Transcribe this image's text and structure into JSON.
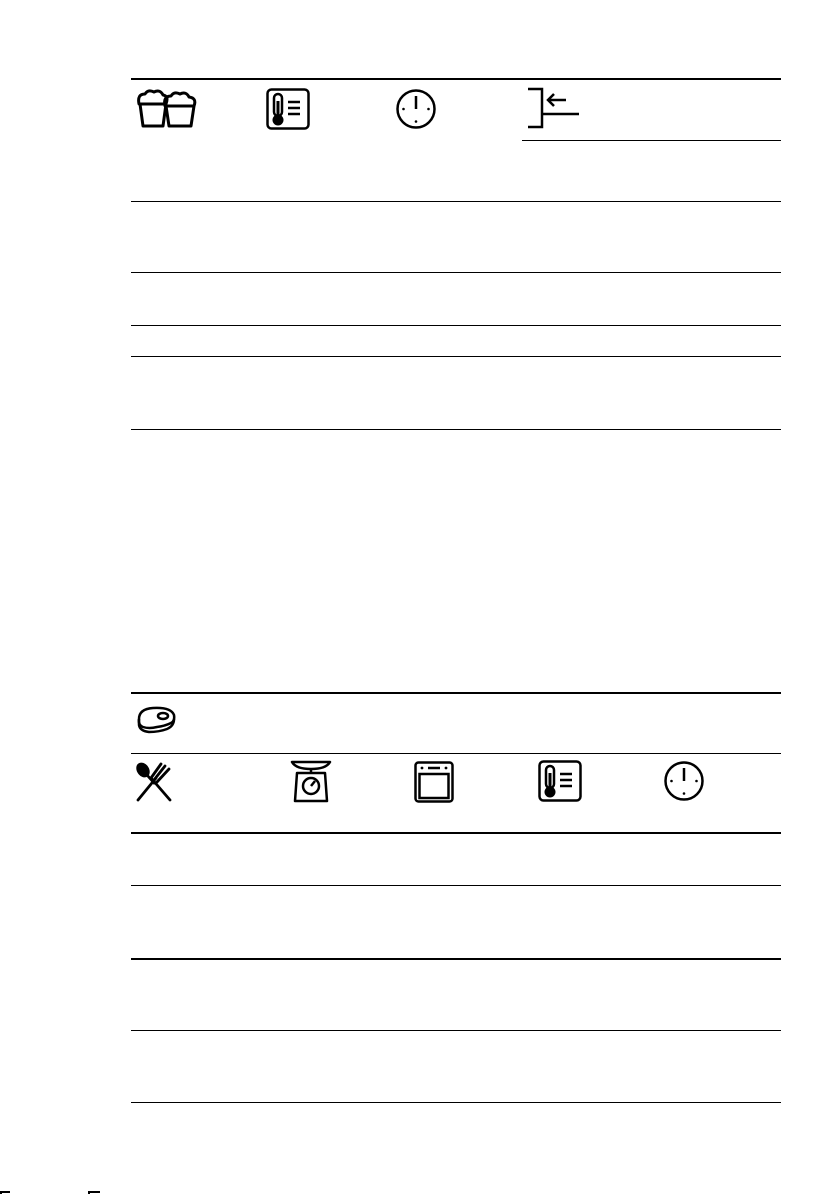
{
  "table_baking": {
    "header_icons": [
      "cakes-icon",
      "thermometer-icon",
      "clock-icon",
      "shelf-position-icon"
    ],
    "rows": [
      {
        "cells": [
          "",
          "",
          "",
          ""
        ]
      },
      {
        "cells": [
          "",
          "",
          "",
          ""
        ]
      },
      {
        "cells": [
          "",
          "",
          "",
          ""
        ]
      },
      {
        "cells": [
          "",
          "",
          "",
          ""
        ]
      }
    ]
  },
  "table_meat": {
    "title_icon": "meat-icon",
    "header_icons": [
      "cutlery-icon",
      "kitchen-scale-icon",
      "oven-icon",
      "thermometer-icon",
      "clock-icon"
    ],
    "rows": [
      {
        "cells": [
          "",
          "",
          "",
          "",
          ""
        ]
      },
      {
        "cells": [
          "",
          "",
          "",
          "",
          ""
        ]
      },
      {
        "cells": [
          "",
          "",
          "",
          "",
          ""
        ]
      },
      {
        "cells": [
          "",
          "",
          "",
          "",
          ""
        ]
      }
    ]
  }
}
